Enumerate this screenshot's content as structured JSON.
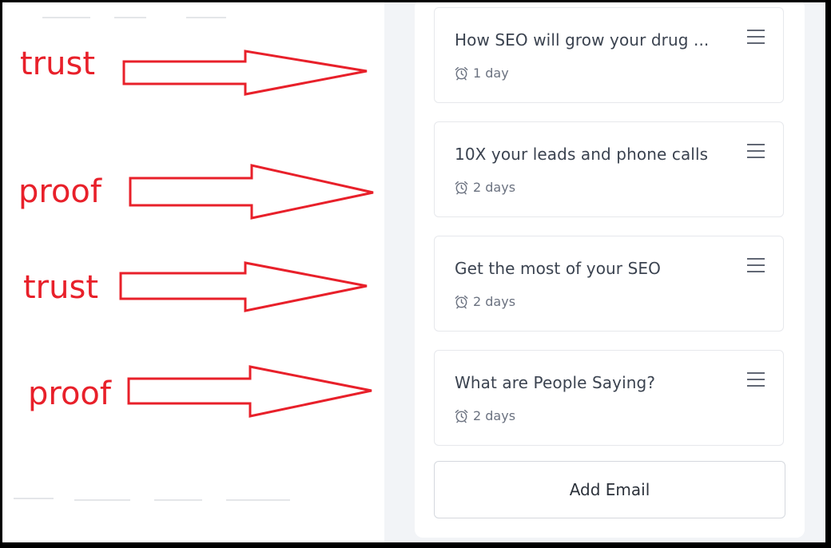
{
  "annotations": [
    {
      "label": "trust"
    },
    {
      "label": "proof"
    },
    {
      "label": "trust"
    },
    {
      "label": "proof"
    }
  ],
  "sequence": {
    "emails": [
      {
        "title": "How SEO will grow your drug ...",
        "delay": "1 day",
        "icon": "alarm-clock-icon"
      },
      {
        "title": "10X your leads and phone calls",
        "delay": "2 days",
        "icon": "alarm-clock-icon"
      },
      {
        "title": "Get the most of your SEO",
        "delay": "2 days",
        "icon": "alarm-clock-icon"
      },
      {
        "title": "What are People Saying?",
        "delay": "2 days",
        "icon": "alarm-clock-icon"
      }
    ],
    "add_button_label": "Add Email"
  },
  "colors": {
    "annotation": "#e8202a",
    "panel_background": "#f2f4f7",
    "text": "#3b4350",
    "muted": "#6b7280"
  }
}
